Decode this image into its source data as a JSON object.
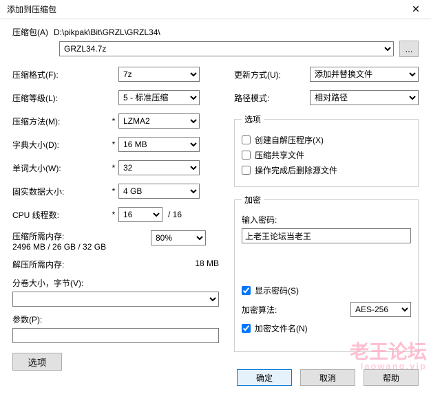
{
  "window": {
    "title": "添加到压缩包"
  },
  "archive": {
    "label": "压缩包(A)",
    "path": "D:\\pikpak\\Bit\\GRZL\\GRZL34\\",
    "filename": "GRZL34.7z",
    "browse": "..."
  },
  "left": {
    "format_label": "压缩格式(F):",
    "format_value": "7z",
    "level_label": "压缩等级(L):",
    "level_value": "5 - 标准压缩",
    "method_label": "压缩方法(M):",
    "method_value": "LZMA2",
    "method_dot": "*",
    "dict_label": "字典大小(D):",
    "dict_value": "16 MB",
    "dict_dot": "*",
    "word_label": "单词大小(W):",
    "word_value": "32",
    "word_dot": "*",
    "solid_label": "固实数据大小:",
    "solid_value": "4 GB",
    "solid_dot": "*",
    "cpu_label": "CPU 线程数:",
    "cpu_value": "16",
    "cpu_dot": "*",
    "cpu_suffix": "/ 16",
    "mem_compress_label": "压缩所需内存:",
    "mem_compress_value": "2496 MB / 26 GB / 32 GB",
    "mem_pct": "80%",
    "mem_decompress_label": "解压所需内存:",
    "mem_decompress_value": "18 MB",
    "volume_label": "分卷大小，字节(V):",
    "param_label": "参数(P):",
    "options_btn": "选项"
  },
  "right": {
    "update_label": "更新方式(U):",
    "update_value": "添加并替换文件",
    "pathmode_label": "路径模式:",
    "pathmode_value": "相对路径",
    "options_legend": "选项",
    "opt_sfx": "创建自解压程序(X)",
    "opt_shared": "压缩共享文件",
    "opt_delete": "操作完成后删除源文件",
    "enc_legend": "加密",
    "pwd_label": "输入密码:",
    "pwd_value": "上老王论坛当老王",
    "show_pwd": "显示密码(S)",
    "alg_label": "加密算法:",
    "alg_value": "AES-256",
    "enc_names": "加密文件名(N)"
  },
  "buttons": {
    "ok": "确定",
    "cancel": "取消",
    "help": "帮助"
  },
  "watermark": {
    "main": "老王论坛",
    "sub": "laowang.vip"
  }
}
